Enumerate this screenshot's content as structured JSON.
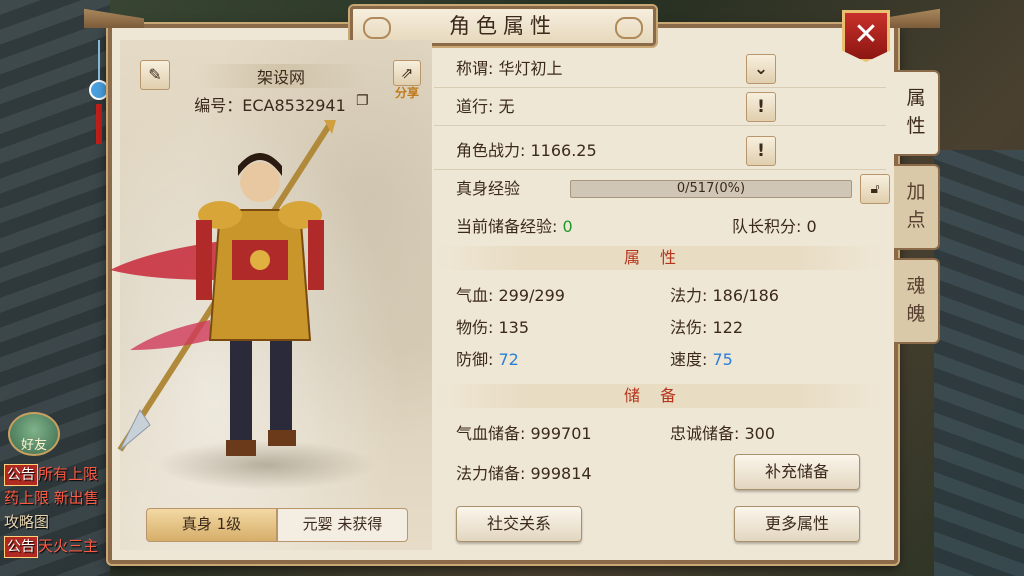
{
  "window": {
    "title": "角色属性",
    "close_icon": "close-icon"
  },
  "character": {
    "name": "架设网",
    "id_label": "编号：",
    "id": "ECA8532941",
    "share_label": "分享",
    "tabs": [
      {
        "label": "真身 1级",
        "active": true
      },
      {
        "label": "元婴 未获得",
        "active": false
      }
    ]
  },
  "info": {
    "title_label": "称谓:",
    "title_value": "华灯初上",
    "daoxing_label": "道行:",
    "daoxing_value": "无",
    "power_label": "角色战力:",
    "power_value": "1166.25",
    "exp_label": "真身经验",
    "exp_text": "0/517(0%)",
    "exp_progress": 0,
    "stored_exp_label": "当前储备经验:",
    "stored_exp_value": "0",
    "captain_label": "队长积分:",
    "captain_value": "0"
  },
  "attributes": {
    "header": "属性",
    "hp_label": "气血:",
    "hp_value": "299/299",
    "mp_label": "法力:",
    "mp_value": "186/186",
    "pattack_label": "物伤:",
    "pattack_value": "135",
    "mattack_label": "法伤:",
    "mattack_value": "122",
    "defense_label": "防御:",
    "defense_value": "72",
    "speed_label": "速度:",
    "speed_value": "75"
  },
  "reserve": {
    "header": "储备",
    "hp_reserve_label": "气血储备:",
    "hp_reserve_value": "999701",
    "loyalty_label": "忠诚储备:",
    "loyalty_value": "300",
    "mp_reserve_label": "法力储备:",
    "mp_reserve_value": "999814",
    "refill_button": "补充储备"
  },
  "buttons": {
    "social": "社交关系",
    "more_attrs": "更多属性"
  },
  "side_tabs": [
    "属性",
    "加点",
    "魂魄"
  ],
  "chat": {
    "friend_label": "好友",
    "lines": [
      {
        "tag": "公告",
        "text": "所有上限"
      },
      {
        "tag": "",
        "text": "药上限 新出售"
      },
      {
        "tag": "",
        "text": "攻略图"
      },
      {
        "tag": "公告",
        "text": "天火三主"
      }
    ]
  },
  "colors": {
    "accent_red": "#b4341c",
    "value_blue": "#2b7fd6",
    "value_green": "#1f9a2a"
  }
}
